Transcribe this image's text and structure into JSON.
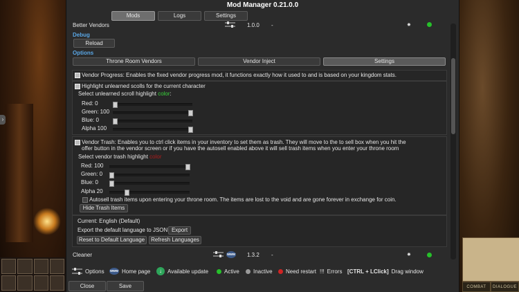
{
  "window": {
    "title": "Mod Manager 0.21.0.0",
    "tabs": [
      "Mods",
      "Logs",
      "Settings"
    ]
  },
  "mods": {
    "top_row": {
      "name": "Better Vendors",
      "version": "1.0.0",
      "extra": "-"
    },
    "bottom_row": {
      "name": "Cleaner",
      "version": "1.3.2",
      "extra": "-",
      "www_text": "www"
    }
  },
  "debug": {
    "heading": "Debug",
    "reload_label": "Reload"
  },
  "options": {
    "heading": "Options",
    "subtabs": [
      "Throne Room Vendors",
      "Vendor Inject",
      "Settings"
    ]
  },
  "vendor_progress": {
    "text": "Vendor Progress: Enables the fixed vendor progress mod, it functions exactly how it used to and is based on your kingdom stats."
  },
  "scroll_highlight": {
    "checkbox_label": "Highlight unlearned scolls for the current character",
    "color_prompt": "Select unlearned scroll highlight ",
    "color_word": "color",
    "color_suffix": ":",
    "sliders": [
      {
        "label": "Red: 0",
        "value": 0
      },
      {
        "label": "Green: 100",
        "value": 100
      },
      {
        "label": "Blue: 0",
        "value": 0
      },
      {
        "label": "Alpha 100",
        "value": 100
      }
    ]
  },
  "vendor_trash": {
    "line1": "Vendor Trash: Enables you to ctrl click items in your inventory to set them as trash. They will move to the to sell box when you hit the",
    "line2": "offer button in the vendor screen or if you have the autosell enabled above it will sell trash items when you enter your throne room",
    "color_prompt": "Select vendor trash highlight ",
    "color_word": "color",
    "sliders": [
      {
        "label": "Red: 100",
        "value": 100
      },
      {
        "label": "Green: 0",
        "value": 0
      },
      {
        "label": "Blue: 0",
        "value": 0
      },
      {
        "label": "Alpha 20",
        "value": 20
      }
    ],
    "autosell_label": "Autosell trash items upon entering your throne room. The items are lost to the void and are gone forever in exchange for coin.",
    "hide_label": "Hide Trash Items"
  },
  "language": {
    "current": "Current: English (Default)",
    "export_prompt": "Export the default language to JSON:",
    "export_label": "Export",
    "reset_label": "Reset to Default Language",
    "refresh_label": "Refresh Languages"
  },
  "footer": {
    "options_label": "Options",
    "homepage_label": "Home page",
    "www_text": "www",
    "update_label": "Available update",
    "active_label": "Active",
    "inactive_label": "Inactive",
    "restart_label": "Need restart",
    "errors_mark": "!!!",
    "errors_label": "Errors",
    "shortcut": "[CTRL + LClick]",
    "drag_label": "Drag window",
    "close_label": "Close",
    "save_label": "Save"
  },
  "game": {
    "tabs": [
      "COMBAT",
      "DIALOGUE"
    ]
  },
  "colors": {
    "accent": "#5aa7e6",
    "active": "#26c02a",
    "restart": "#d02424",
    "window_bg": "#2b2b2b"
  }
}
